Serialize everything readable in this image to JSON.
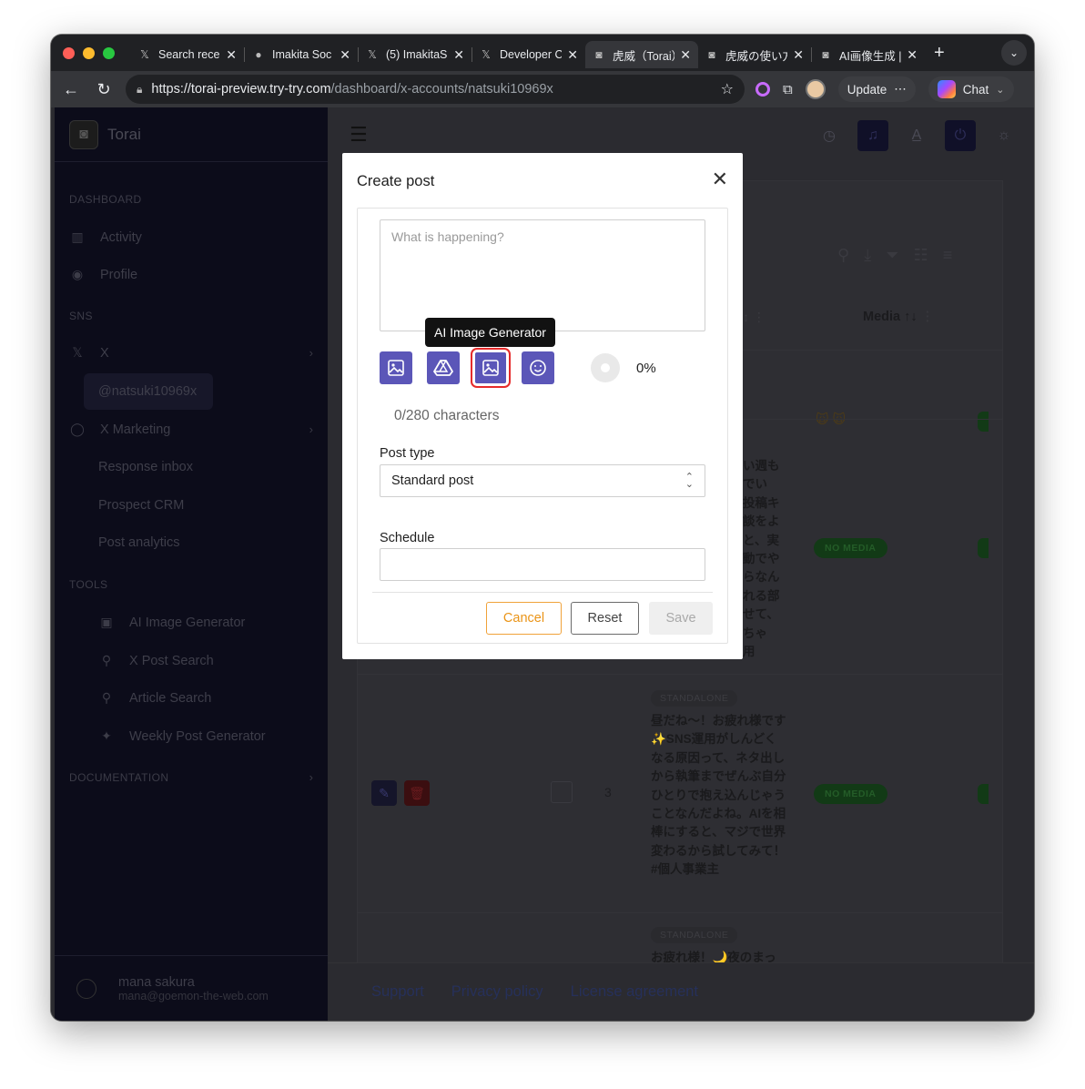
{
  "browser": {
    "tabs": [
      {
        "icon": "x-logo-icon",
        "title": "Search rece"
      },
      {
        "icon": "imakita-logo-icon",
        "title": "Imakita Soc"
      },
      {
        "icon": "x-logo-icon",
        "title": "(5) ImakitaS"
      },
      {
        "icon": "x-logo-icon",
        "title": "Developer C"
      },
      {
        "icon": "torai-logo-icon",
        "title": "虎威（Torai）",
        "active": true
      },
      {
        "icon": "torai-logo-icon",
        "title": "虎威の使い方"
      },
      {
        "icon": "torai-logo-icon",
        "title": "AI画像生成 |"
      }
    ],
    "url_host": "https://torai-preview.try-try.com",
    "url_path": "/dashboard/x-accounts/natsuki10969x",
    "update_label": "Update",
    "chat_label": "Chat"
  },
  "sidebar": {
    "brand": "Torai",
    "sections": {
      "dashboard": "DASHBOARD",
      "sns": "SNS",
      "tools": "TOOLS",
      "documentation": "DOCUMENTATION"
    },
    "items": {
      "activity": "Activity",
      "profile": "Profile",
      "x": "X",
      "account": "@natsuki10969x",
      "x_marketing": "X Marketing",
      "response_inbox": "Response inbox",
      "prospect_crm": "Prospect CRM",
      "post_analytics": "Post analytics",
      "ai_image_generator": "AI Image Generator",
      "x_post_search": "X Post Search",
      "article_search": "Article Search",
      "weekly_post_generator": "Weekly Post Generator"
    },
    "user": {
      "name": "mana sakura",
      "email": "mana@goemon-the-web.com"
    }
  },
  "table": {
    "media_header": "Media ↑↓",
    "row1_text": "い週も\nでい\n投稿キ\n談をよ\nと、実\n動でや\nらなん\nれる部\nせて、\nちゃ\n用",
    "row2": {
      "tag": "STANDALONE",
      "number": "3",
      "text": "昼だね〜！お疲れ様です✨SNS運用がしんどくなる原因って、ネタ出しから執筆までぜんぶ自分ひとりで抱え込んじゃうことなんだよね。AIを相棒にすると、マジで世界変わるから試してみて！ #個人事業主",
      "media": "NO MEDIA"
    },
    "row1_media": "NO MEDIA",
    "row3": {
      "tag": "STANDALONE",
      "text": "お疲れ様！🌙夜のまっ"
    }
  },
  "footer": {
    "support": "Support",
    "privacy": "Privacy policy",
    "license": "License agreement"
  },
  "modal": {
    "title": "Create post",
    "placeholder": "What is happening?",
    "tooltip": "AI Image Generator",
    "progress": "0%",
    "char_count": "0/280 characters",
    "post_type_label": "Post type",
    "post_type_value": "Standard post",
    "schedule_label": "Schedule",
    "cancel_label": "Cancel",
    "reset_label": "Reset",
    "save_label": "Save",
    "accent_color": "#5b56b8",
    "highlight_color": "#e52b2b"
  }
}
